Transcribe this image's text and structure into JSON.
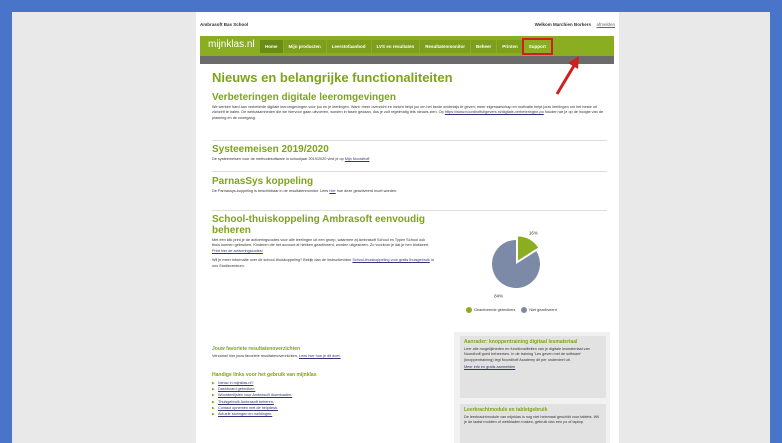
{
  "topbar": {
    "school": "Ambrasoft Bas School",
    "welcome": "Welkom Marchien Borkers",
    "logout": "afmelden"
  },
  "nav": {
    "logo": "mijnklas.nl",
    "items": [
      "Home",
      "Mijn producten",
      "Leerstofaanbod",
      "LVS en resultaten",
      "Resultatenmonitor",
      "Beheer",
      "Printen",
      "Support"
    ]
  },
  "main": {
    "title": "Nieuws en belangrijke functionaliteiten",
    "s1": {
      "title": "Verbeteringen digitale leeromgevingen",
      "text": "We werken hard aan verbeterde digitale leeromgevingen voor jou en je leerlingen. Want: meer overzicht en inzicht helpt jou om het beste onderwijs te geven; meer eigenaarschap en motivatie helpt jouw leerlingen om het beste uit zichzelf te halen. De werkzaamheden die we hiervoor gaan uitvoeren, worden in fasen gedaan, dus je zult regelmatig iets nieuws zien. Op",
      "link": "https://www.noordhoffuitgevers.nl/digitale-verbeteringen-po",
      "text2": "houden we je op de hoogte van de planning en de voortgang."
    },
    "s2": {
      "title": "Systeemeisen 2019/2020",
      "text": "De systeemeisen voor de methodesoftware in schooljaar 2019/2020 vind je op",
      "link": "Mijn Noordhoff"
    },
    "s3": {
      "title": "ParnasSys koppeling",
      "text": "De Parnassys-koppeling is beschikbaar in de resultatenmonitor. Lees",
      "link": "hier",
      "text2": "hoe deze geactiveerd moet worden."
    },
    "s4": {
      "title": "School-thuiskoppeling Ambrasoft eenvoudig beheren",
      "text": "Met één klik print je de activeringscodes voor alle leerlingen uit een groep, waarmee zij Ambrasoft School en Typen School ook thuis kunnen gebruiken. Kinderen die het account al hebben geactiveerd, worden uitgesloten. Zo voorkom je dat je hen blokkeert.",
      "link": "Print hier de activeringscodes!",
      "text2": "Wil je meer informatie over de school-thuiskoppeling? Bekijk dan de instructievideo",
      "link2": "School-thuiskoppeling voor gratis thuisgebruik",
      "text3": "in ons Studiecentrum."
    }
  },
  "chart_data": {
    "type": "pie",
    "categories": [
      "Geactiveerde gebruikers",
      "Niet geactiveerd"
    ],
    "values": [
      16,
      84
    ],
    "labels": [
      "16%",
      "84%"
    ],
    "colors": [
      "#8aad22",
      "#7d8aa7"
    ],
    "legend": "bottom"
  },
  "lower": {
    "fav_title": "Jouw favoriete resultatenoverzichten",
    "fav_text": "Verzamel hier jouw favoriete resultatenoverzichten.",
    "fav_link": "Lees hier hoe je dit doet.",
    "links_title": "Handige links voor het gebruik van mijnklas",
    "links": [
      "Nieuw in mijnklas.nl?",
      "Dashboard gebruiken.",
      "Woordenlijsten voor Ambrasoft downloaden.",
      "Thuisgebruik Ambrasoft beheren.",
      "Contact opnemen met de helpdesk.",
      "Actuele storingen en meldingen."
    ],
    "r1_title": "Aanrader: knoppentraining digitaal lesmateriaal",
    "r1_text": "Leer alle mogelijkheden en functionaliteiten van je digitale lesmateriaal van Noordhoff goed beheersen. In de training 'Les geven met de software' (knoppentraining) legt Noordhoff Academy dit per onderdeel uit.",
    "r1_link": "Meer info en gratis aanmelden",
    "r2_title": "Leerkrachtmodule en tabletgebruik",
    "r2_text": "De leerkrachtmodule van mijnklas is nog niet helemaal geschikt voor tablets. Wil je de laatst mobilen of webbladen maken, gebruik dan een pc of laptop."
  }
}
